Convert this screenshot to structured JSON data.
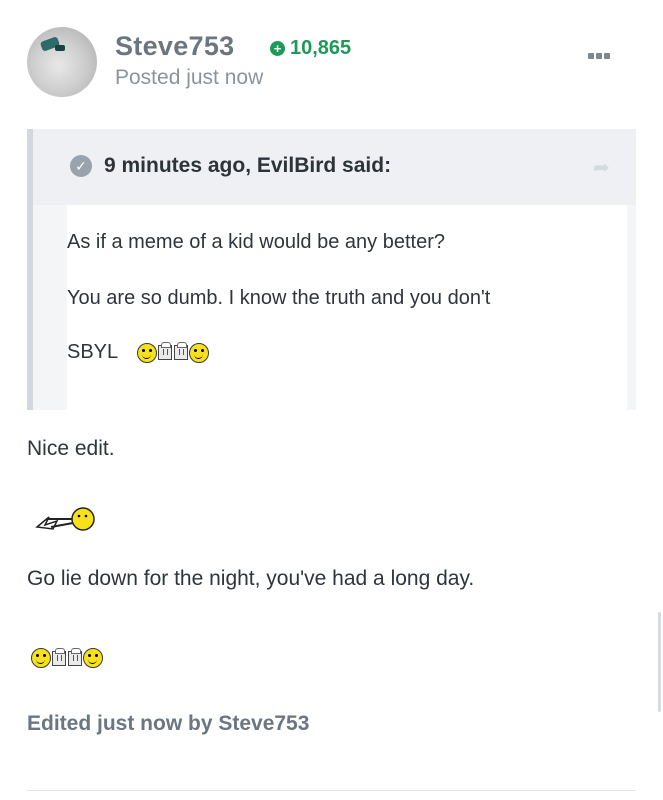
{
  "author": {
    "username": "Steve753",
    "reputation": "10,865",
    "posted": "Posted just now"
  },
  "quote": {
    "citation": "9 minutes ago, EvilBird said:",
    "lines": [
      "As if a meme of a kid would be any better?",
      "You are so dumb. I know the truth and you don't",
      "SBYL"
    ]
  },
  "body": {
    "line1": "Nice edit.",
    "line2": "Go lie down for the night, you've had a long day."
  },
  "footer": {
    "edited": "Edited just now by Steve753"
  },
  "icons": {
    "reputation": "plus-circle-icon",
    "menu": "more-icon",
    "quote_toggle": "check-circle-icon",
    "share": "share-arrow-icon",
    "emoticon_cheers": "cheers-smilies-icon",
    "emoticon_lie_down": "lie-down-smiley-icon"
  },
  "colors": {
    "reputation": "#1d9a58",
    "username": "#6b7680",
    "quote_bg": "#f3f5f7"
  }
}
